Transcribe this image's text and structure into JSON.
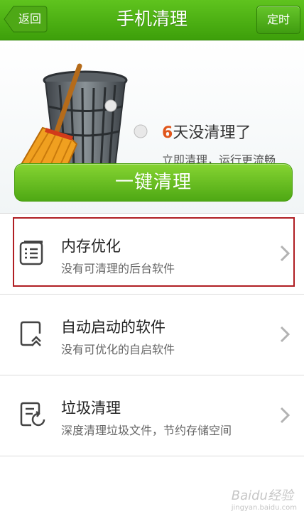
{
  "header": {
    "title": "手机清理",
    "back_label": "返回",
    "timer_label": "定时"
  },
  "hero": {
    "days_number": "6",
    "days_text": "天没清理了",
    "subtitle": "立即清理，运行更流畅"
  },
  "clean_button": {
    "label": "一键清理"
  },
  "list": [
    {
      "title": "内存优化",
      "desc": "没有可清理的后台软件",
      "icon": "memory-list-icon"
    },
    {
      "title": "自动启动的软件",
      "desc": "没有可优化的自启软件",
      "icon": "autostart-icon"
    },
    {
      "title": "垃圾清理",
      "desc": "深度清理垃圾文件，节约存储空间",
      "icon": "junk-clean-icon"
    }
  ],
  "watermark": {
    "text": "Baidu经验",
    "sub": "jingyan.baidu.com"
  },
  "colors": {
    "header_green": "#4aa815",
    "button_green": "#6cc324",
    "accent_orange": "#e0561b",
    "highlight_red": "#b01e23"
  }
}
